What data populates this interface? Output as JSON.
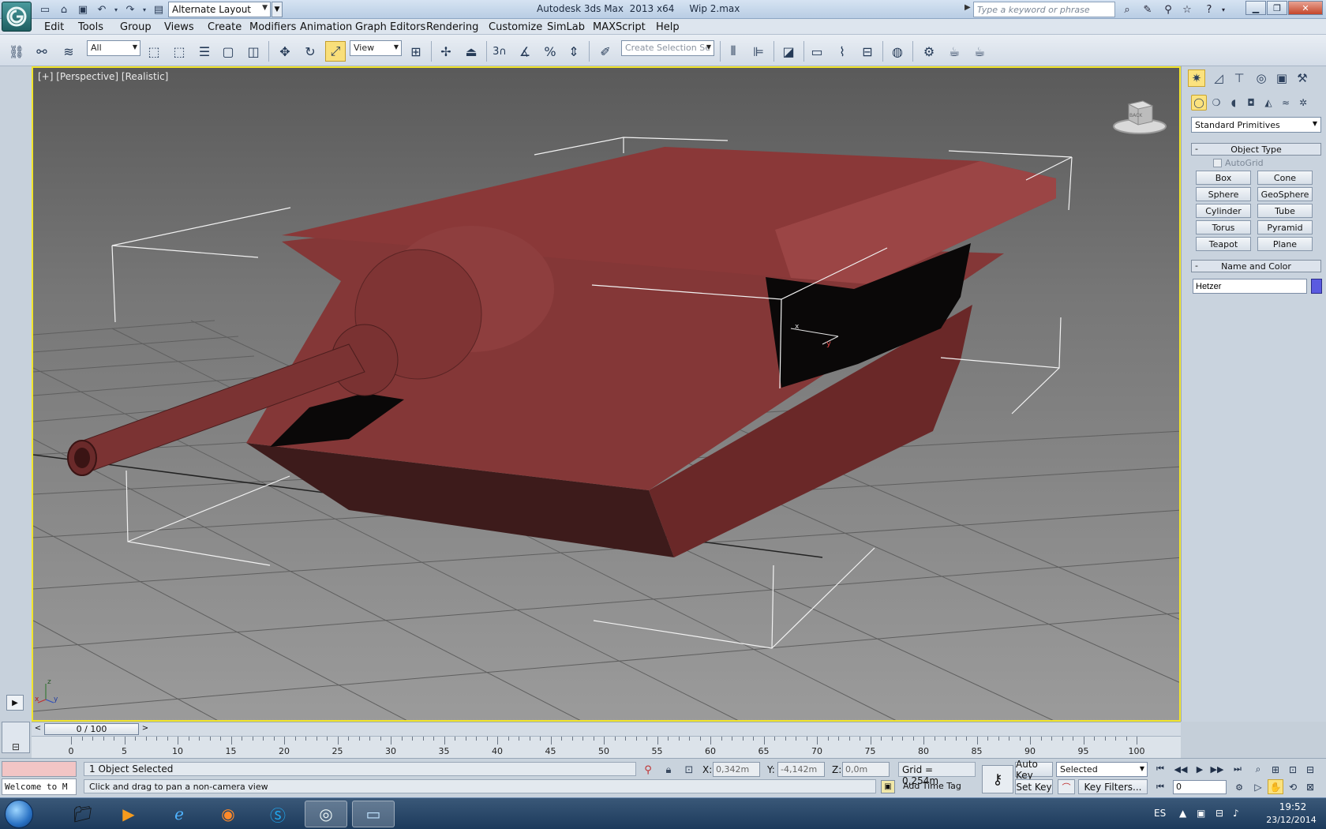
{
  "titlebar": {
    "workspace": "Alternate Layout",
    "title": "Autodesk 3ds Max  2013 x64     Wip 2.max",
    "search_placeholder": "Type a keyword or phrase"
  },
  "menu": [
    "Edit",
    "Tools",
    "Group",
    "Views",
    "Create",
    "Modifiers",
    "Animation",
    "Graph Editors",
    "Rendering",
    "Customize",
    "SimLab",
    "MAXScript",
    "Help"
  ],
  "toolbar": {
    "filter": "All",
    "ref_coord": "View",
    "snap_number": "3",
    "selection_set_placeholder": "Create Selection Se"
  },
  "viewport": {
    "label": "[+] [Perspective] [Realistic]",
    "object_color": "#7a2f2f",
    "background_color": "#858585",
    "axis_labels": {
      "x": "x",
      "y": "y",
      "z": "z"
    }
  },
  "command_panel": {
    "category": "Standard Primitives",
    "object_type_title": "Object Type",
    "autogrid": "AutoGrid",
    "buttons": [
      "Box",
      "Cone",
      "Sphere",
      "GeoSphere",
      "Cylinder",
      "Tube",
      "Torus",
      "Pyramid",
      "Teapot",
      "Plane"
    ],
    "name_color_title": "Name and Color",
    "object_name": "Hetzer",
    "object_wire_color": "#5a5ae0"
  },
  "timeline": {
    "frame_display": "0 / 100",
    "ticks": [
      0,
      5,
      10,
      15,
      20,
      25,
      30,
      35,
      40,
      45,
      50,
      55,
      60,
      65,
      70,
      75,
      80,
      85,
      90,
      95,
      100
    ]
  },
  "status": {
    "listener": "Welcome to M",
    "selection": "1 Object Selected",
    "prompt": "Click and drag to pan a non-camera view",
    "x_label": "X:",
    "x": "0,342m",
    "y_label": "Y:",
    "y": "-4,142m",
    "z_label": "Z:",
    "z": "0,0m",
    "grid": "Grid = 0,254m",
    "add_time_tag": "Add Time Tag",
    "auto_key": "Auto Key",
    "set_key": "Set Key",
    "key_mode": "Selected",
    "key_filters": "Key Filters...",
    "frame": "0"
  },
  "taskbar": {
    "lang": "ES",
    "time": "19:52",
    "date": "23/12/2014"
  }
}
